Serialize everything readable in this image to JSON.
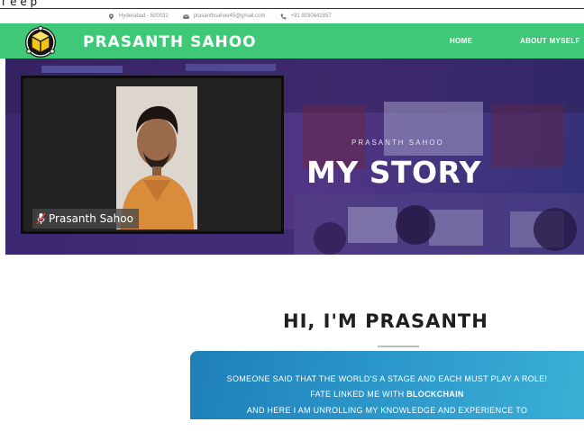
{
  "partial_text": "T e e p",
  "contact": {
    "location": "Hyderabad - 500032",
    "email": "prasanthsahoo45@gmail.com",
    "phone": "+91 9030642857"
  },
  "navbar": {
    "brand": "PRASANTH SAHOO",
    "links": [
      "HOME",
      "ABOUT MYSELF"
    ]
  },
  "hero": {
    "kicker": "PRASANTH SAHOO",
    "title": "MY STORY"
  },
  "video": {
    "participant_name": "Prasanth Sahoo"
  },
  "intro": {
    "heading": "HI, I'M PRASANTH",
    "line1": "SOMEONE SAID THAT THE WORLD'S A STAGE AND EACH MUST PLAY A ROLE!",
    "line2_prefix": "FATE LINKED ME WITH ",
    "line2_strong": "BLOCKCHAIN",
    "line3": "AND HERE I AM UNROLLING MY KNOWLEDGE AND EXPERIENCE TO"
  },
  "colors": {
    "nav_green": "#3ec877",
    "hero_purple": "#4f3a86",
    "box_blue": "#2a95c9"
  },
  "icons": [
    "map-pin-icon",
    "envelope-icon",
    "phone-icon",
    "cube-logo-icon",
    "microphone-muted-icon"
  ]
}
